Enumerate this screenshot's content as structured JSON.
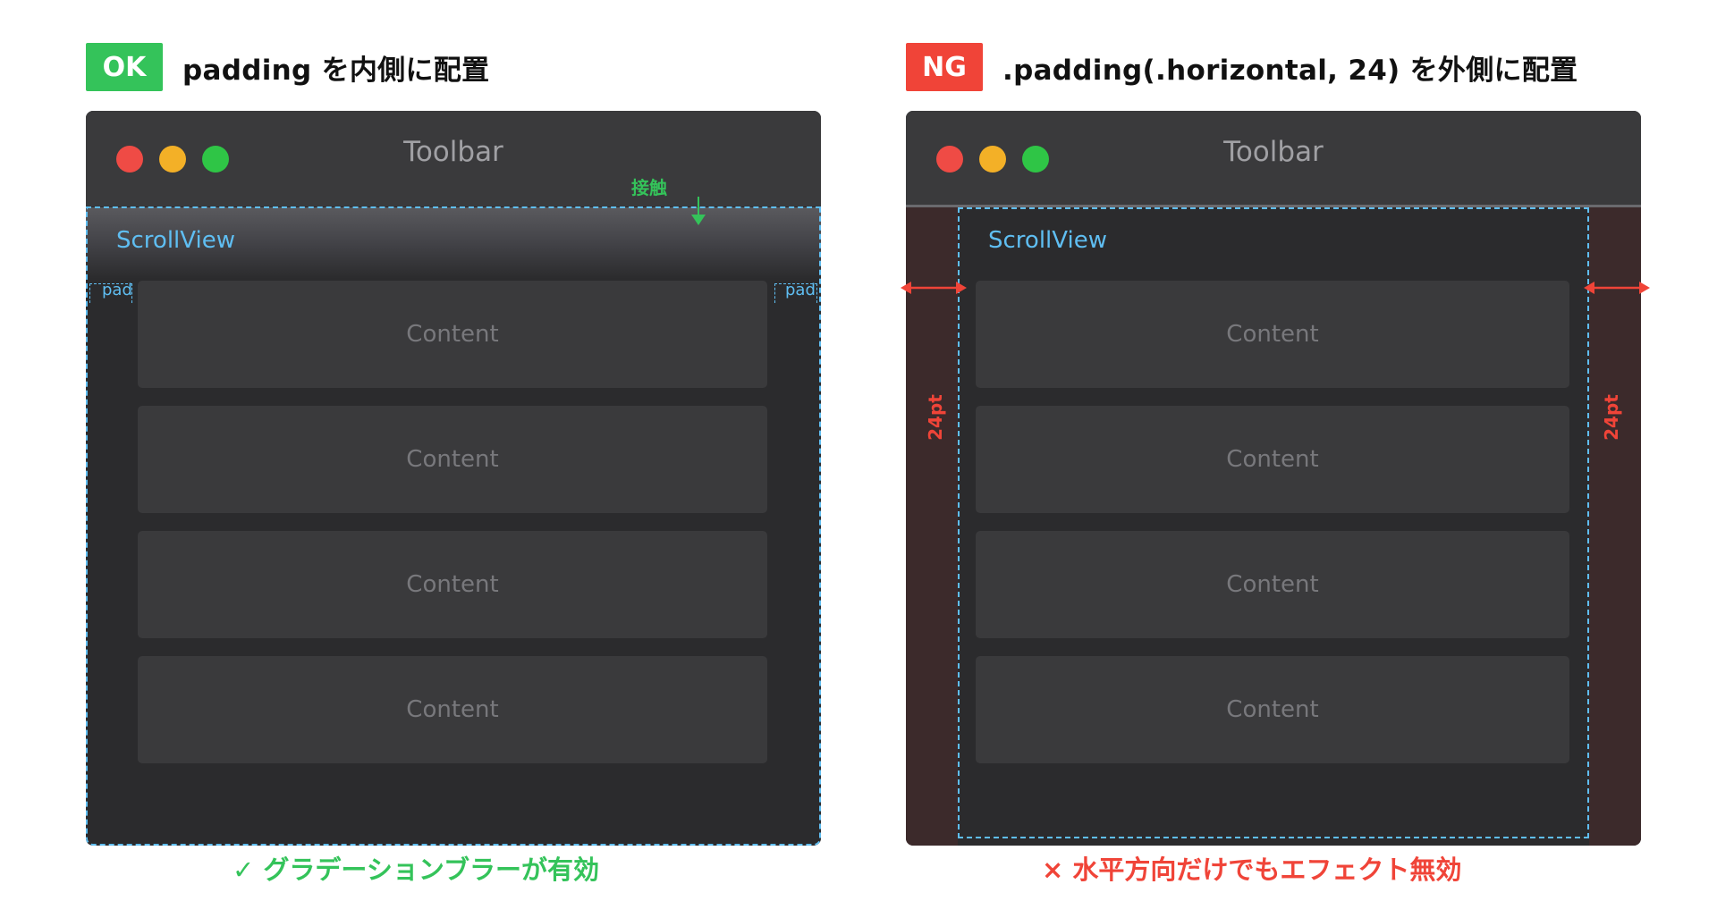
{
  "colors": {
    "ok_green": "#34c35a",
    "ng_red": "#f04438",
    "scroll_blue": "#5fbef2",
    "light_red": "#ef4b45",
    "light_yellow": "#f3b027",
    "light_green": "#2fc546"
  },
  "ok_panel": {
    "badge": "OK",
    "heading": "padding を内側に配置",
    "toolbar_title": "Toolbar",
    "scroll_label": "ScrollView",
    "contact_label": "接触",
    "pad_left": "pad",
    "pad_right": "pad",
    "contents": [
      "Content",
      "Content",
      "Content",
      "Content"
    ],
    "footer": "✓ グラデーションブラーが有効"
  },
  "ng_panel": {
    "badge": "NG",
    "heading": ".padding(.horizontal, 24) を外側に配置",
    "toolbar_title": "Toolbar",
    "scroll_label": "ScrollView",
    "pad_left": "24pt",
    "pad_right": "24pt",
    "contents": [
      "Content",
      "Content",
      "Content",
      "Content"
    ],
    "footer": "× 水平方向だけでもエフェクト無効"
  }
}
